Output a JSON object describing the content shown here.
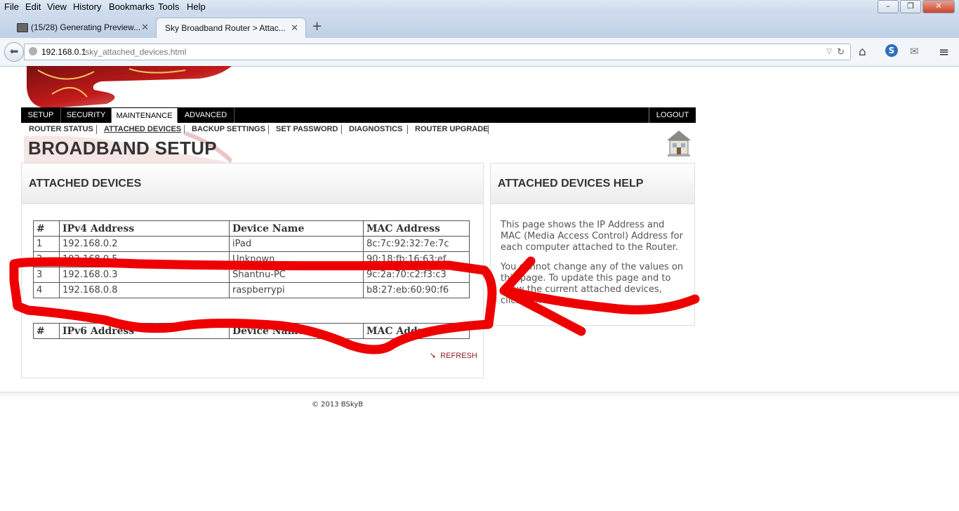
{
  "browser": {
    "menu": [
      "File",
      "Edit",
      "View",
      "History",
      "Bookmarks",
      "Tools",
      "Help"
    ],
    "window_controls": {
      "minimize": "–",
      "maximize": "❐",
      "close": "✕"
    },
    "tabs": [
      {
        "title": "(15/28) Generating Preview...",
        "icon": "book-icon",
        "active": false
      },
      {
        "title": "Sky Broadband Router > Attac...",
        "active": true
      }
    ],
    "new_tab_label": "+",
    "url": {
      "host": "192.168.0.1",
      "path": "/sky_attached_devices.html"
    }
  },
  "router": {
    "topnav": {
      "items": [
        "SETUP",
        "SECURITY",
        "MAINTENANCE",
        "ADVANCED"
      ],
      "active": "MAINTENANCE",
      "logout": "LOGOUT"
    },
    "subnav": {
      "items": [
        "ROUTER STATUS",
        "ATTACHED DEVICES",
        "BACKUP SETTINGS",
        "SET PASSWORD",
        "DIAGNOSTICS",
        "ROUTER UPGRADE"
      ],
      "current": "ATTACHED DEVICES"
    },
    "page_title": "BROADBAND SETUP",
    "attached_panel": {
      "title": "ATTACHED DEVICES",
      "ipv4_table": {
        "headers": [
          "#",
          "IPv4 Address",
          "Device Name",
          "MAC Address"
        ],
        "rows": [
          [
            "1",
            "192.168.0.2",
            "iPad",
            "8c:7c:92:32:7e:7c"
          ],
          [
            "2",
            "192.168.0.5",
            "Unknown",
            "90:18:fb:16:63:ef"
          ],
          [
            "3",
            "192.168.0.3",
            "Shantnu-PC",
            "9c:2a:70:c2:f3:c3"
          ],
          [
            "4",
            "192.168.0.8",
            "raspberrypi",
            "b8:27:eb:60:90:f6"
          ]
        ]
      },
      "ipv6_table": {
        "headers": [
          "#",
          "IPv6 Address",
          "Device Name",
          "MAC Address"
        ]
      },
      "refresh_label": "REFRESH"
    },
    "help_panel": {
      "title": "ATTACHED DEVICES HELP",
      "paragraphs": [
        "This page shows the IP Address and MAC (Media Access Control) Address for each computer attached to the Router.",
        "You cannot change any of the values on this page. To update this page and to show the current attached devices, click Refresh."
      ]
    },
    "footer": "© 2013 BSkyB"
  },
  "annotation_color": "#ee0000"
}
